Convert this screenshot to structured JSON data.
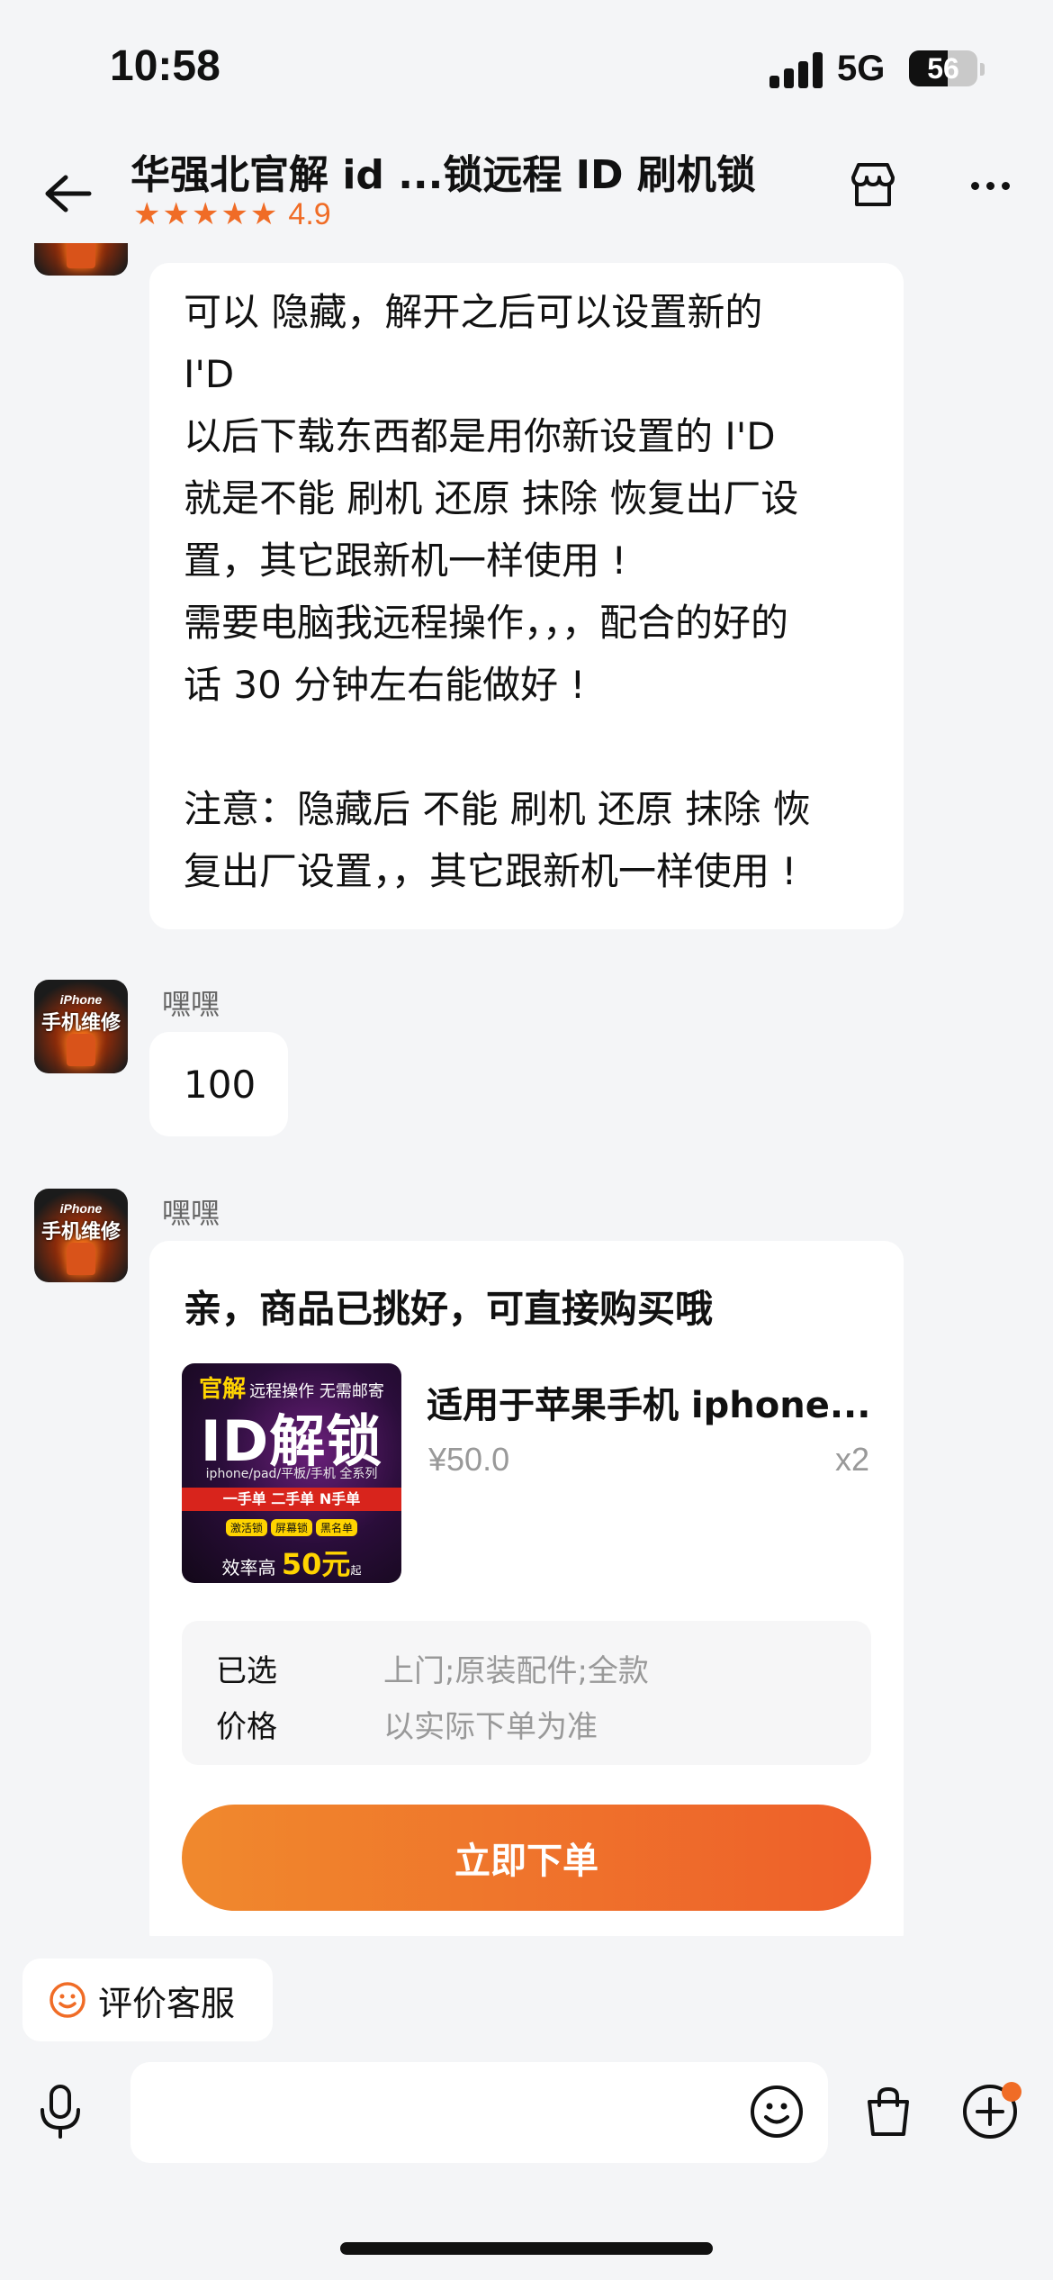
{
  "status_bar": {
    "time": "10:58",
    "network": "5G",
    "battery": "56",
    "battery_level": 0.56
  },
  "header": {
    "title": "华强北官解 id ...锁远程 ID 刷机锁",
    "stars": "★★★★★",
    "rating": "4.9"
  },
  "messages": [
    {
      "text": "可以 隐藏，解开之后可以设置新的\nI'D\n以后下载东西都是用你新设置的 I'D\n就是不能 刷机 还原 抹除 恢复出厂设\n置，其它跟新机一样使用 !\n需要电脑我远程操作，，，配合的好的\n话 30 分钟左右能做好 !\n\n注意：隐藏后 不能 刷机 还原 抹除 恢\n复出厂设置，，其它跟新机一样使用 !"
    },
    {
      "sender": "嘿嘿",
      "text": "100"
    },
    {
      "sender": "嘿嘿"
    }
  ],
  "avatar": {
    "top": "iPhone",
    "main": "手机维修"
  },
  "product_card": {
    "title": "亲，商品已挑好，可直接购买哦",
    "image": {
      "badge": "官解",
      "top_text": "远程操作 无需邮寄",
      "main": "ID解锁",
      "sub": "iphone/pad/平板/手机  全系列",
      "band": "一手单  二手单  N手单",
      "tags": [
        "激活锁",
        "屏幕锁",
        "黑名单"
      ],
      "price_prefix": "效率高",
      "price": "50元",
      "price_suffix": "起"
    },
    "product_name": "适用于苹果手机 iphone...",
    "price": "¥50.0",
    "quantity": "x2",
    "specs": [
      {
        "key": "已选",
        "value": "上门;原装配件;全款"
      },
      {
        "key": "价格",
        "value": "以实际下单为准"
      }
    ],
    "order_button": "立即下单"
  },
  "rate_chip": {
    "label": "评价客服"
  },
  "input": {
    "placeholder": ""
  },
  "colors": {
    "accent": "#f06c26",
    "background": "#f4f5f7"
  }
}
